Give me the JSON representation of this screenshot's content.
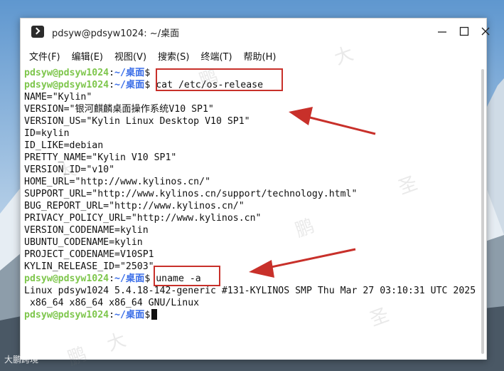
{
  "window": {
    "title": "pdsyw@pdsyw1024: ~/桌面"
  },
  "window_controls": {
    "minimize_icon": "minimize-icon",
    "maximize_icon": "maximize-icon",
    "close_icon": "close-icon"
  },
  "menu": [
    {
      "label": "文件(F)"
    },
    {
      "label": "编辑(E)"
    },
    {
      "label": "视图(V)"
    },
    {
      "label": "搜索(S)"
    },
    {
      "label": "终端(T)"
    },
    {
      "label": "帮助(H)"
    }
  ],
  "prompt": {
    "user": "pdsyw@pdsyw1024",
    "sep": ":",
    "path": "~/桌面",
    "symbol": "$"
  },
  "terminal": {
    "cmd1": " cat /etc/os-release",
    "cmd2": " uname -a",
    "output1": [
      "NAME=\"Kylin\"",
      "VERSION=\"银河麒麟桌面操作系统V10 SP1\"",
      "VERSION_US=\"Kylin Linux Desktop V10 SP1\"",
      "ID=kylin",
      "ID_LIKE=debian",
      "PRETTY_NAME=\"Kylin V10 SP1\"",
      "VERSION_ID=\"v10\"",
      "HOME_URL=\"http://www.kylinos.cn/\"",
      "SUPPORT_URL=\"http://www.kylinos.cn/support/technology.html\"",
      "BUG_REPORT_URL=\"http://www.kylinos.cn/\"",
      "PRIVACY_POLICY_URL=\"http://www.kylinos.cn\"",
      "VERSION_CODENAME=kylin",
      "UBUNTU_CODENAME=kylin",
      "PROJECT_CODENAME=V10SP1",
      "KYLIN_RELEASE_ID=\"2503\""
    ],
    "output2": [
      "Linux pdsyw1024 5.4.18-142-generic #131-KYLINOS SMP Thu Mar 27 03:10:31 UTC 2025",
      " x86_64 x86_64 x86_64 GNU/Linux"
    ]
  },
  "watermark": {
    "chars": [
      "大",
      "鹏",
      "圣",
      "大",
      "鹏",
      "圣",
      "大",
      "鹏"
    ],
    "corner": "大鹏跨境"
  },
  "colors": {
    "prompt_user": "#7ec64c",
    "prompt_path": "#3a6ee8",
    "highlight": "#c8302a"
  }
}
